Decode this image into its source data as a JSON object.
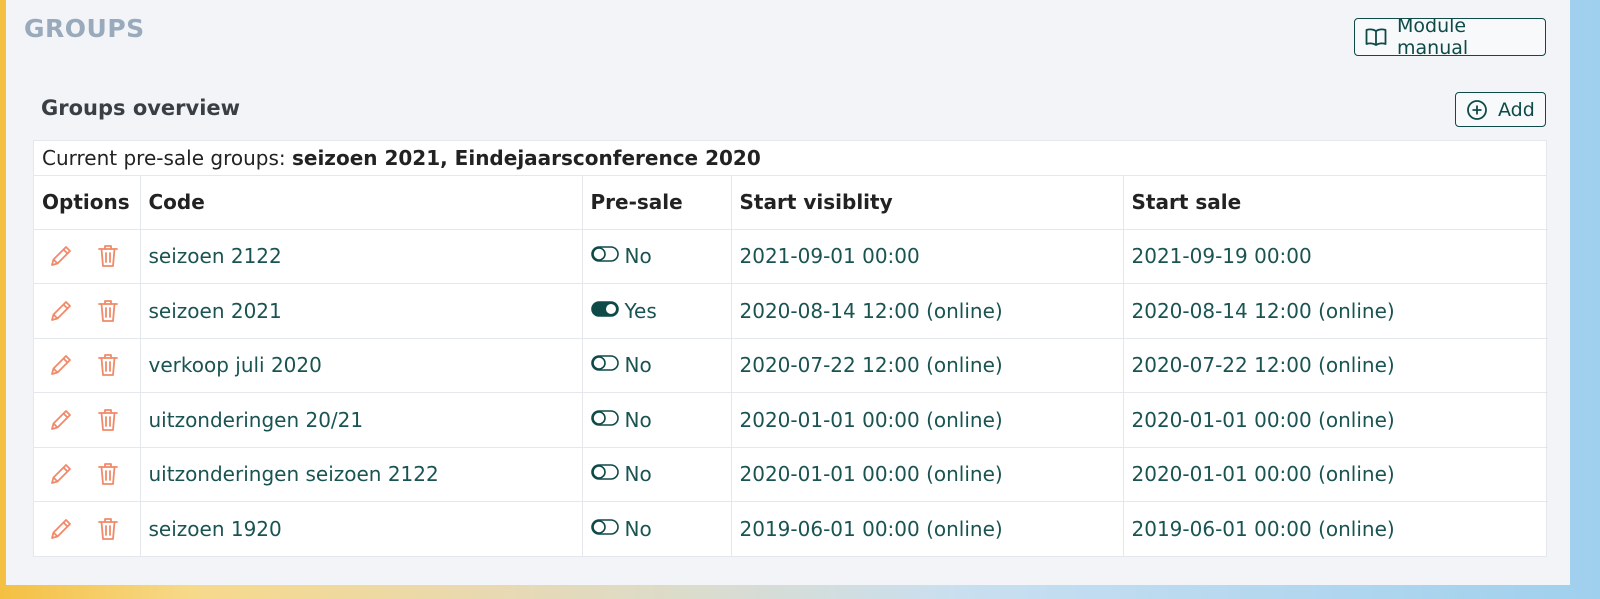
{
  "header": {
    "title": "GROUPS",
    "manual_label": "Module manual"
  },
  "overview": {
    "title": "Groups overview",
    "add_label": "Add",
    "presale_prefix": "Current pre-sale groups: ",
    "presale_groups": "seizoen 2021, Eindejaarsconference 2020"
  },
  "table": {
    "columns": [
      "Options",
      "Code",
      "Pre-sale",
      "Start visiblity",
      "Start sale"
    ],
    "rows": [
      {
        "code": "seizoen 2122",
        "presale": false,
        "presale_label": "No",
        "start_visibility": "2021-09-01 00:00",
        "start_sale": "2021-09-19 00:00"
      },
      {
        "code": "seizoen 2021",
        "presale": true,
        "presale_label": "Yes",
        "start_visibility": "2020-08-14 12:00 (online)",
        "start_sale": "2020-08-14 12:00 (online)"
      },
      {
        "code": "verkoop juli 2020",
        "presale": false,
        "presale_label": "No",
        "start_visibility": "2020-07-22 12:00 (online)",
        "start_sale": "2020-07-22 12:00 (online)"
      },
      {
        "code": "uitzonderingen 20/21",
        "presale": false,
        "presale_label": "No",
        "start_visibility": "2020-01-01 00:00 (online)",
        "start_sale": "2020-01-01 00:00 (online)"
      },
      {
        "code": "uitzonderingen seizoen 2122",
        "presale": false,
        "presale_label": "No",
        "start_visibility": "2020-01-01 00:00 (online)",
        "start_sale": "2020-01-01 00:00 (online)"
      },
      {
        "code": "seizoen 1920",
        "presale": false,
        "presale_label": "No",
        "start_visibility": "2019-06-01 00:00 (online)",
        "start_sale": "2019-06-01 00:00 (online)"
      }
    ]
  },
  "icons": {
    "edit": "pencil-icon",
    "delete": "trash-icon",
    "toggle_off": "toggle-off-icon",
    "toggle_on": "toggle-on-icon",
    "manual": "book-open-icon",
    "add": "plus-circle-icon"
  },
  "colors": {
    "accent": "#0e4a48",
    "text_teal": "#1a5452",
    "action_orange": "#f08a6a",
    "title_muted": "#98aabb",
    "panel_bg": "#f2f4f7"
  }
}
